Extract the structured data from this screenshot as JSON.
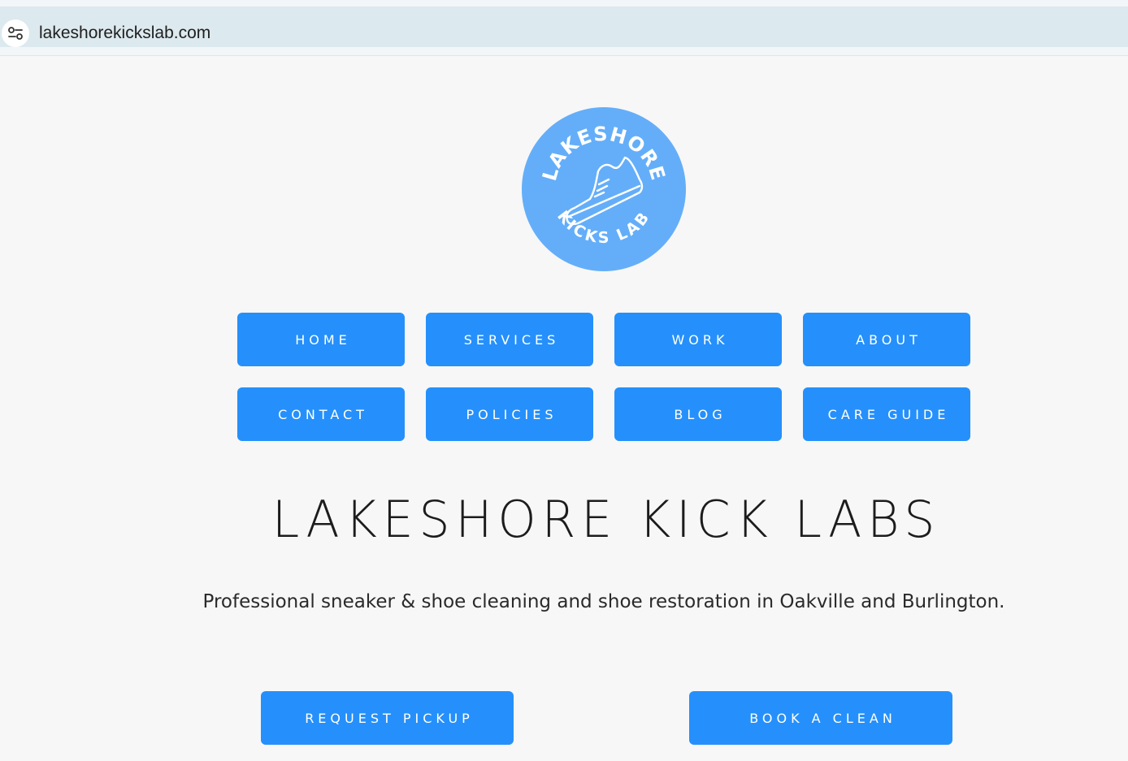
{
  "browser": {
    "url": "lakeshorekickslab.com",
    "site_settings_icon": "tune-icon"
  },
  "logo": {
    "text_top": "LAKESHORE",
    "text_bottom": "KICKS LAB",
    "icon": "sneaker-icon",
    "background_color": "#64aef9"
  },
  "nav": {
    "items": [
      {
        "label": "HOME"
      },
      {
        "label": "SERVICES"
      },
      {
        "label": "WORK"
      },
      {
        "label": "ABOUT"
      },
      {
        "label": "CONTACT"
      },
      {
        "label": "POLICIES"
      },
      {
        "label": "BLOG"
      },
      {
        "label": "CARE GUIDE"
      }
    ]
  },
  "hero": {
    "title": "LAKESHORE KICK LABS",
    "subtitle": "Professional sneaker & shoe cleaning and shoe restoration in Oakville and Burlington."
  },
  "cta": {
    "request_pickup": "REQUEST PICKUP",
    "book_clean": "BOOK A CLEAN"
  },
  "colors": {
    "accent": "#2590fb",
    "page_background": "#f7f7f7",
    "address_bar": "#dce9ee"
  }
}
